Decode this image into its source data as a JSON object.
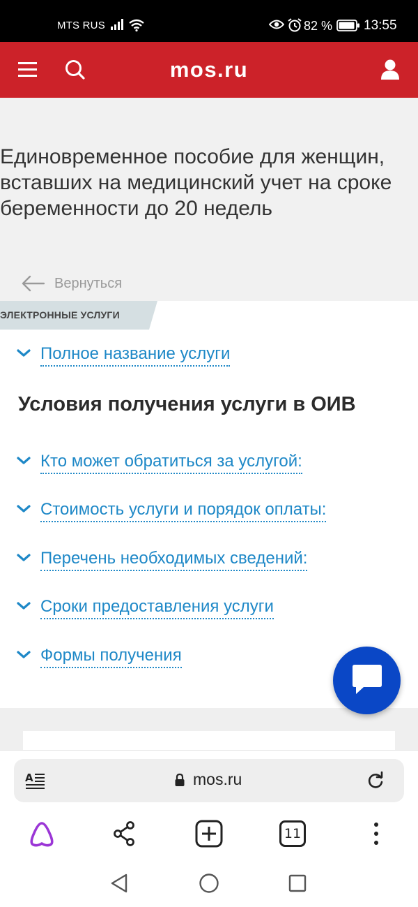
{
  "status_bar": {
    "carrier": "MTS RUS",
    "battery_percent": "82 %",
    "time": "13:55",
    "icons": [
      "signal-icon",
      "wifi-icon",
      "eye-icon",
      "alarm-icon",
      "battery-icon"
    ]
  },
  "header": {
    "logo": "mos.ru",
    "brand_color": "#cc2229",
    "icons": [
      "menu-icon",
      "search-icon",
      "user-icon"
    ]
  },
  "page": {
    "title": "Единовременное пособие для женщин, вставших на медицинский учет на сроке беременности до 20 недель",
    "back_label": "Вернуться",
    "service_tag": "ЭЛЕКТРОННЫЕ УСЛУГИ"
  },
  "accordions_top": [
    {
      "label": "Полное название услуги"
    }
  ],
  "section_title": "Условия получения услуги в ОИВ",
  "accordions": [
    {
      "label": "Кто может обратиться за услугой:"
    },
    {
      "label": "Стоимость услуги и порядок оплаты:"
    },
    {
      "label": "Перечень необходимых сведений:"
    },
    {
      "label": "Сроки предоставления услуги"
    },
    {
      "label": "Формы получения"
    }
  ],
  "link_color": "#1e88c7",
  "chat_fab": {
    "icon": "chat-icon",
    "color": "#0a47c6"
  },
  "browser": {
    "url": "mos.ru",
    "tab_count": "11",
    "icons": [
      "reader-mode-icon",
      "lock-icon",
      "reload-icon",
      "alice-icon",
      "share-icon",
      "new-tab-icon",
      "tabs-icon",
      "more-icon"
    ]
  },
  "nav_bar": {
    "icons": [
      "back-triangle-icon",
      "home-circle-icon",
      "recent-square-icon"
    ]
  }
}
